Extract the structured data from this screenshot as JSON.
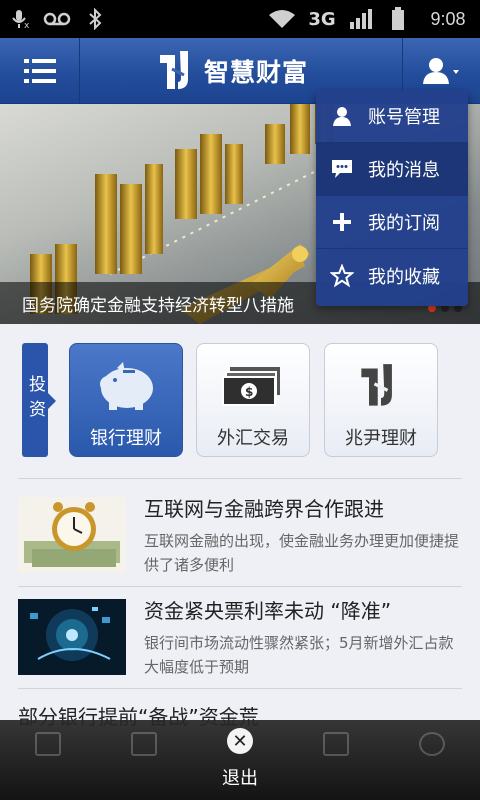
{
  "status_bar": {
    "time": "9:08",
    "network": "3G"
  },
  "header": {
    "brand": "智慧财富",
    "menu_icon": "menu-icon",
    "user_icon": "user-icon"
  },
  "banner": {
    "caption": "国务院确定金融支持经济转型八措施",
    "page_count": 3,
    "active_page": 1
  },
  "dropdown": {
    "items": [
      {
        "label": "账号管理",
        "icon": "user-icon"
      },
      {
        "label": "我的消息",
        "icon": "message-icon"
      },
      {
        "label": "我的订阅",
        "icon": "plus-icon"
      },
      {
        "label": "我的收藏",
        "icon": "star-icon"
      }
    ]
  },
  "quick_entries": {
    "section_label": "投资",
    "items": [
      {
        "label": "银行理财",
        "icon": "piggy-bank-icon",
        "active": true
      },
      {
        "label": "外汇交易",
        "icon": "banknote-icon",
        "active": false
      },
      {
        "label": "兆尹理财",
        "icon": "logo-icon",
        "active": false
      }
    ]
  },
  "news": [
    {
      "title": "互联网与金融跨界合作跟进",
      "summary": "互联网金融的出现，使金融业务办理更加便捷提供了诸多便利"
    },
    {
      "title": "资金紧央票利率未动 “降准”",
      "summary": "银行间市场流动性骤然紧张；5月新增外汇占款大幅度低于预期"
    },
    {
      "title": "部分银行提前“备战”资金荒"
    }
  ],
  "exit": {
    "label": "退出"
  },
  "colors": {
    "header": "#234e9c",
    "accent": "#2a55aa",
    "dropdown": "#23408c",
    "active_dot": "#e0391f"
  }
}
